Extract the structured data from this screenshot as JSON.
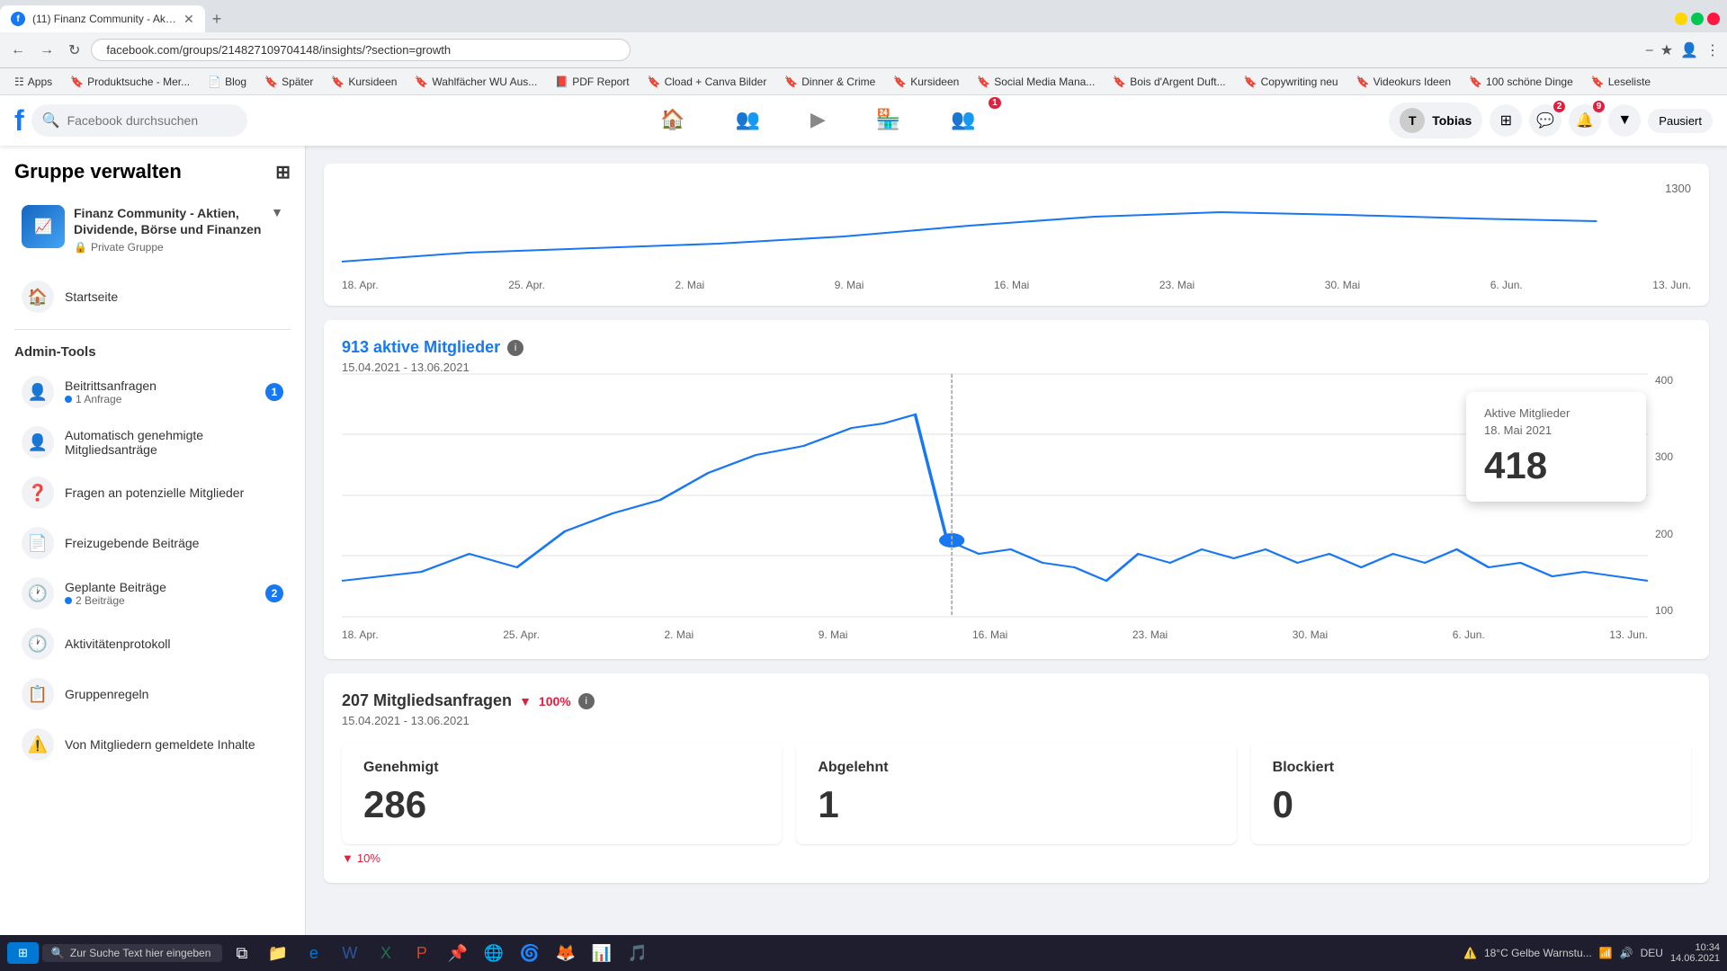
{
  "browser": {
    "tab_title": "(11) Finanz Community - Aktien...",
    "tab_favicon": "f",
    "address": "facebook.com/groups/214827109704148/insights/?section=growth",
    "bookmarks": [
      {
        "label": "Apps"
      },
      {
        "label": "Produktsuche - Mer..."
      },
      {
        "label": "Blog"
      },
      {
        "label": "Später"
      },
      {
        "label": "Kursideen"
      },
      {
        "label": "Wahlfächer WU Aus..."
      },
      {
        "label": "PDF Report"
      },
      {
        "label": "Cload + Canva Bilder"
      },
      {
        "label": "Dinner & Crime"
      },
      {
        "label": "Kursideen"
      },
      {
        "label": "Social Media Mana..."
      },
      {
        "label": "Bois d'Argent Duft..."
      },
      {
        "label": "Copywriting neu"
      },
      {
        "label": "Videokurs Ideen"
      },
      {
        "label": "100 schöne Dinge"
      },
      {
        "label": "Leseliste"
      }
    ]
  },
  "facebook": {
    "search_placeholder": "Facebook durchsuchen",
    "user_name": "Tobias",
    "paused_label": "Pausiert"
  },
  "sidebar": {
    "title": "Gruppe verwalten",
    "group_name": "Finanz Community - Aktien, Dividende, Börse und Finanzen",
    "group_type": "Private Gruppe",
    "startseite_label": "Startseite",
    "admin_tools_label": "Admin-Tools",
    "items": [
      {
        "label": "Beitrittsanfragen",
        "badge": "1",
        "sub": "1 Anfrage"
      },
      {
        "label": "Automatisch genehmigte Mitgliedsanträge"
      },
      {
        "label": "Fragen an potenzielle Mitglieder"
      },
      {
        "label": "Freizugebende Beiträge"
      },
      {
        "label": "Geplante Beiträge",
        "badge": "2",
        "sub": "2 Beiträge"
      },
      {
        "label": "Aktivitätenprotokoll"
      },
      {
        "label": "Gruppenregeln"
      },
      {
        "label": "Von Mitgliedern gemeldete Inhalte"
      }
    ]
  },
  "top_chart": {
    "y_labels": [
      "1300",
      "",
      "",
      "",
      ""
    ],
    "x_labels": [
      "18. Apr.",
      "25. Apr.",
      "2. Mai",
      "9. Mai",
      "16. Mai",
      "23. Mai",
      "30. Mai",
      "6. Jun.",
      "13. Jun."
    ]
  },
  "active_members": {
    "title": "913 aktive Mitglieder",
    "date_range": "15.04.2021 - 13.06.2021",
    "tooltip_label": "Aktive Mitglieder",
    "tooltip_date": "18. Mai 2021",
    "tooltip_value": "418",
    "y_labels": [
      "400",
      "300",
      "200",
      "100"
    ],
    "x_labels": [
      "18. Apr.",
      "25. Apr.",
      "2. Mai",
      "9. Mai",
      "16. Mai",
      "23. Mai",
      "30. Mai",
      "6. Jun.",
      "13. Jun."
    ]
  },
  "member_requests": {
    "title": "207 Mitgliedsanfragen",
    "percent": "100%",
    "date_range": "15.04.2021 - 13.06.2021",
    "approved_label": "Genehmigt",
    "approved_value": "286",
    "rejected_label": "Abgelehnt",
    "rejected_value": "1",
    "blocked_label": "Blockiert",
    "blocked_value": "0",
    "change_label": "10%"
  },
  "taskbar": {
    "search_placeholder": "Zur Suche Text hier eingeben",
    "time": "10:34",
    "date": "14.06.2021",
    "weather": "18°C  Gelbe Warnstu...",
    "language": "DEU"
  }
}
